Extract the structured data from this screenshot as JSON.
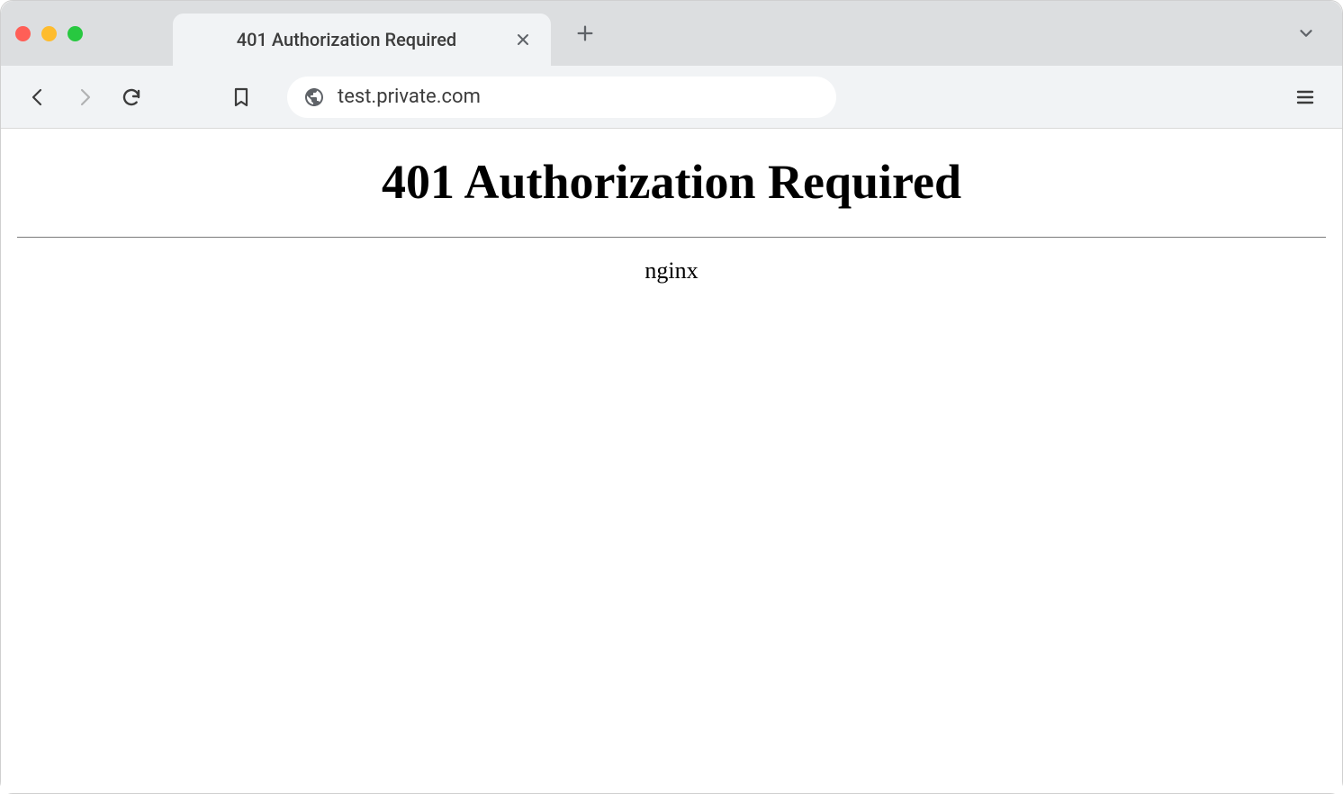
{
  "tab": {
    "title": "401 Authorization Required"
  },
  "address": {
    "url": "test.private.com"
  },
  "page": {
    "heading": "401 Authorization Required",
    "server": "nginx"
  }
}
